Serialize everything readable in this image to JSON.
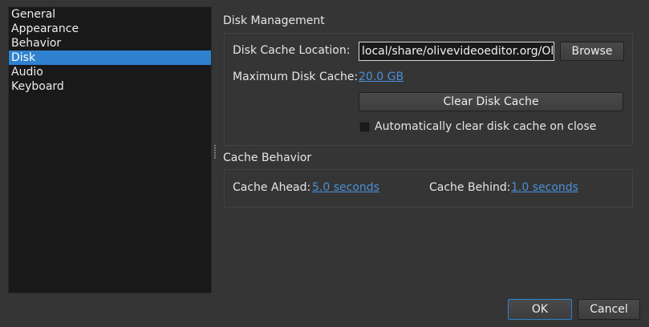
{
  "sidebar": {
    "items": [
      {
        "label": "General"
      },
      {
        "label": "Appearance"
      },
      {
        "label": "Behavior"
      },
      {
        "label": "Disk",
        "selected": true
      },
      {
        "label": "Audio"
      },
      {
        "label": "Keyboard"
      }
    ]
  },
  "disk_management": {
    "title": "Disk Management",
    "cache_location_label": "Disk Cache Location:",
    "cache_location_value": "local/share/olivevideoeditor.org/Olive",
    "browse_label": "Browse",
    "max_cache_label": "Maximum Disk Cache:",
    "max_cache_value": "20.0 GB",
    "clear_cache_label": "Clear Disk Cache",
    "auto_clear_label": "Automatically clear disk cache on close",
    "auto_clear_checked": false
  },
  "cache_behavior": {
    "title": "Cache Behavior",
    "ahead_label": "Cache Ahead:",
    "ahead_value": "5.0 seconds",
    "behind_label": "Cache Behind:",
    "behind_value": "1.0 seconds"
  },
  "dialog_buttons": {
    "ok_label": "OK",
    "cancel_label": "Cancel"
  },
  "colors": {
    "selection": "#2f82d0",
    "link": "#4a90d8",
    "background": "#353535",
    "panel": "#191919"
  }
}
